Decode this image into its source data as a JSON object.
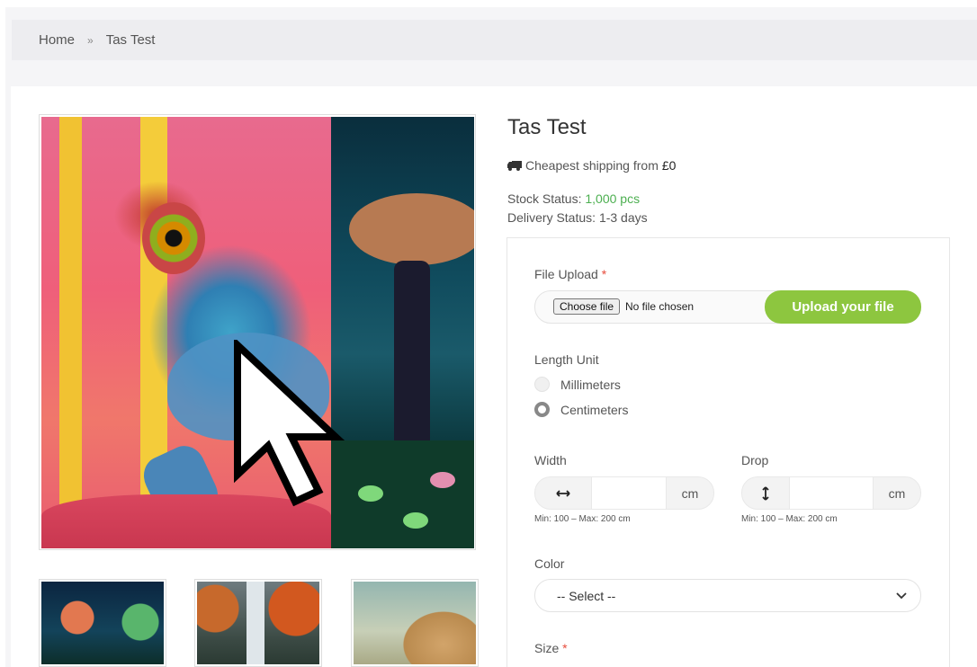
{
  "breadcrumb": {
    "home": "Home",
    "separator": "»",
    "current": "Tas Test"
  },
  "product": {
    "title": "Tas Test",
    "shipping_prefix": "Cheapest shipping from",
    "shipping_price": "£0",
    "stock_label": "Stock Status:",
    "stock_value": "1,000 pcs",
    "delivery_label": "Delivery Status:",
    "delivery_value": "1-3 days"
  },
  "form": {
    "file_upload": {
      "label": "File Upload",
      "required_mark": "*",
      "choose_label": "Choose file",
      "no_file": "No file chosen",
      "upload_button": "Upload your file"
    },
    "length_unit": {
      "label": "Length Unit",
      "options": [
        "Millimeters",
        "Centimeters"
      ],
      "selected": "Centimeters"
    },
    "width": {
      "label": "Width",
      "unit": "cm",
      "hint": "Min: 100 – Max: 200 cm",
      "value": ""
    },
    "drop": {
      "label": "Drop",
      "unit": "cm",
      "hint": "Min: 100 – Max: 200 cm",
      "value": ""
    },
    "color": {
      "label": "Color",
      "selected": "-- Select --"
    },
    "size": {
      "label": "Size",
      "required_mark": "*"
    }
  },
  "icons": {
    "shipping": "truck-icon",
    "width": "horizontal-arrows-icon",
    "drop": "vertical-arrows-icon",
    "select": "chevron-down-icon",
    "pointer": "mouse-pointer-icon"
  },
  "colors": {
    "accent": "#8dc63f",
    "stock_green": "#4caf50",
    "required_red": "#e74c3c"
  }
}
